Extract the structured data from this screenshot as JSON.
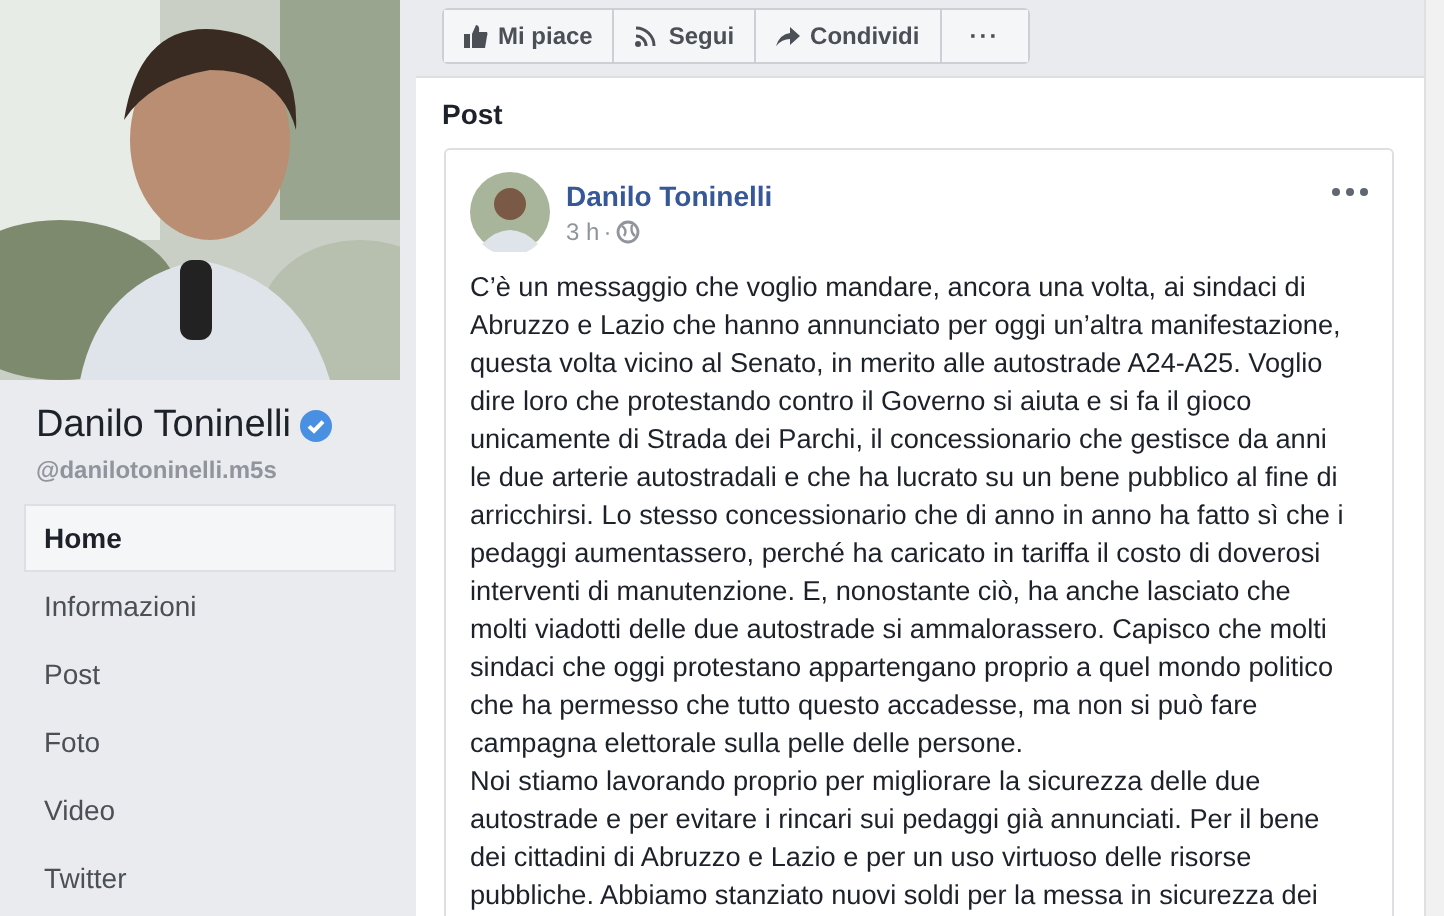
{
  "profile": {
    "name": "Danilo Toninelli",
    "verified": true,
    "handle": "@danilotoninelli.m5s"
  },
  "nav": [
    {
      "label": "Home",
      "selected": true
    },
    {
      "label": "Informazioni",
      "selected": false
    },
    {
      "label": "Post",
      "selected": false
    },
    {
      "label": "Foto",
      "selected": false
    },
    {
      "label": "Video",
      "selected": false
    },
    {
      "label": "Twitter",
      "selected": false
    }
  ],
  "actions": [
    {
      "kind": "like",
      "label": "Mi piace"
    },
    {
      "kind": "follow",
      "label": "Segui"
    },
    {
      "kind": "share",
      "label": "Condividi"
    },
    {
      "kind": "more",
      "label": "···"
    }
  ],
  "section_title": "Post",
  "post": {
    "author": "Danilo Toninelli",
    "time": "3 h",
    "separator": "·",
    "public": true,
    "paragraphs": [
      "C’è un messaggio che voglio mandare, ancora una volta, ai sindaci di\nAbruzzo e Lazio che hanno annunciato per oggi un’altra manifestazione,\nquesta volta vicino al Senato, in merito alle autostrade A24-A25. Voglio\ndire loro che protestando contro il Governo si aiuta e si fa il gioco\nunicamente di Strada dei Parchi, il concessionario che gestisce da anni\nle due arterie autostradali e che ha lucrato su un bene pubblico al fine di\narricchirsi. Lo stesso concessionario che di anno in anno ha fatto sì che i\npedaggi aumentassero, perché ha caricato in tariffa il costo di doverosi\ninterventi di manutenzione. E, nonostante ciò, ha anche lasciato che\nmolti viadotti delle due autostrade si ammalorassero. Capisco che molti\nsindaci che oggi protestano appartengano proprio a quel mondo politico\nche ha permesso che tutto questo accadesse, ma non si può fare\ncampagna elettorale sulla pelle delle persone.",
      "Noi stiamo lavorando proprio per migliorare la sicurezza delle due\nautostrade e per evitare i rincari sui pedaggi già annunciati. Per il bene\ndei cittadini di Abruzzo e Lazio e per un uso virtuoso delle risorse\npubbliche. Abbiamo stanziato nuovi soldi per la messa in sicurezza dei"
    ]
  }
}
